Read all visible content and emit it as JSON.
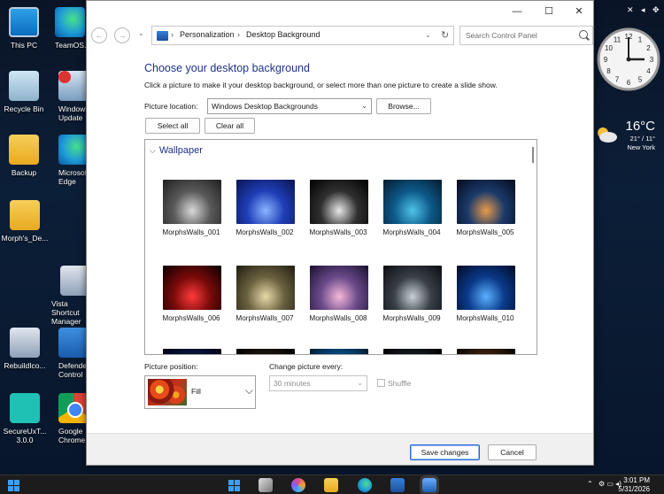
{
  "desktop": {
    "icons": [
      {
        "label": "This PC"
      },
      {
        "label": "TeamOS..."
      },
      {
        "label": "Recycle Bin"
      },
      {
        "label": "Windows Update"
      },
      {
        "label": "Backup"
      },
      {
        "label": "Microsoft Edge"
      },
      {
        "label": "Morph's_De..."
      },
      {
        "label": "Vista Shortcut Manager"
      },
      {
        "label": "RebuildIco..."
      },
      {
        "label": "Defender Control"
      },
      {
        "label": "SecureUxT... 3.0.0"
      },
      {
        "label": "Google Chrome"
      }
    ]
  },
  "clock": {
    "numerals": [
      "12",
      "1",
      "2",
      "3",
      "4",
      "5",
      "6",
      "7",
      "8",
      "9",
      "10",
      "11"
    ]
  },
  "weather": {
    "temp": "16°C",
    "range": "21° / 11°",
    "city": "New York"
  },
  "window": {
    "caption": {
      "minimize": "—",
      "maximize": "☐",
      "close": "✕"
    },
    "nav": {
      "back": "←",
      "forward": "→",
      "recent": "⌄"
    },
    "breadcrumb": [
      "Personalization",
      "Desktop Background"
    ],
    "breadcrumb_sep": "›",
    "refresh": "↻",
    "search_placeholder": "Search Control Panel",
    "heading": "Choose your desktop background",
    "subtitle": "Click a picture to make it your desktop background, or select more than one picture to create a slide show.",
    "picture_location_label": "Picture location:",
    "picture_location_value": "Windows Desktop Backgrounds",
    "browse_label": "Browse...",
    "select_all_label": "Select all",
    "clear_all_label": "Clear all",
    "group_name": "Wallpaper",
    "thumbnails": [
      {
        "label": "MorphsWalls_001",
        "colors": [
          "#d9d9d9",
          "#5a5a5a",
          "#1f1f1f"
        ]
      },
      {
        "label": "MorphsWalls_002",
        "colors": [
          "#8ab4ff",
          "#1f3fb8",
          "#0a1450"
        ]
      },
      {
        "label": "MorphsWalls_003",
        "colors": [
          "#e8e8e8",
          "#303030",
          "#000000"
        ]
      },
      {
        "label": "MorphsWalls_004",
        "colors": [
          "#4fc3e8",
          "#0d5a8a",
          "#041a2c"
        ]
      },
      {
        "label": "MorphsWalls_005",
        "colors": [
          "#e89a4a",
          "#1b3a6a",
          "#050a1c"
        ]
      },
      {
        "label": "MorphsWalls_006",
        "colors": [
          "#ff3a3a",
          "#7a0a0a",
          "#0a0000"
        ]
      },
      {
        "label": "MorphsWalls_007",
        "colors": [
          "#e8d9a8",
          "#6b6240",
          "#1f1c10"
        ]
      },
      {
        "label": "MorphsWalls_008",
        "colors": [
          "#f5b8d8",
          "#6a4a8a",
          "#1a1030"
        ]
      },
      {
        "label": "MorphsWalls_009",
        "colors": [
          "#c8d0d8",
          "#3a4048",
          "#0a0c10"
        ]
      },
      {
        "label": "MorphsWalls_010",
        "colors": [
          "#5ab0ff",
          "#0a3a8a",
          "#020a24"
        ]
      },
      {
        "label": "",
        "colors": [
          "#3a6aff",
          "#0a1a4a",
          "#000010"
        ]
      },
      {
        "label": "",
        "colors": [
          "#6a5040",
          "#201810",
          "#000000"
        ]
      },
      {
        "label": "",
        "colors": [
          "#3ac8ff",
          "#0a5a9a",
          "#02182a"
        ]
      },
      {
        "label": "",
        "colors": [
          "#5a6a7a",
          "#1a2028",
          "#000000"
        ]
      },
      {
        "label": "",
        "colors": [
          "#ffb040",
          "#4a2a10",
          "#000000"
        ]
      }
    ],
    "picture_position_label": "Picture position:",
    "picture_position_value": "Fill",
    "change_every_label": "Change picture every:",
    "change_every_value": "30 minutes",
    "shuffle_label": "Shuffle",
    "save_label": "Save changes",
    "cancel_label": "Cancel"
  },
  "taskbar": {
    "time": "3:01 PM",
    "date": "5/31/2026"
  },
  "colors": {
    "accent": "#1e3287",
    "primary_border": "#2a6ad9",
    "taskbar": "#1c1c1c"
  }
}
